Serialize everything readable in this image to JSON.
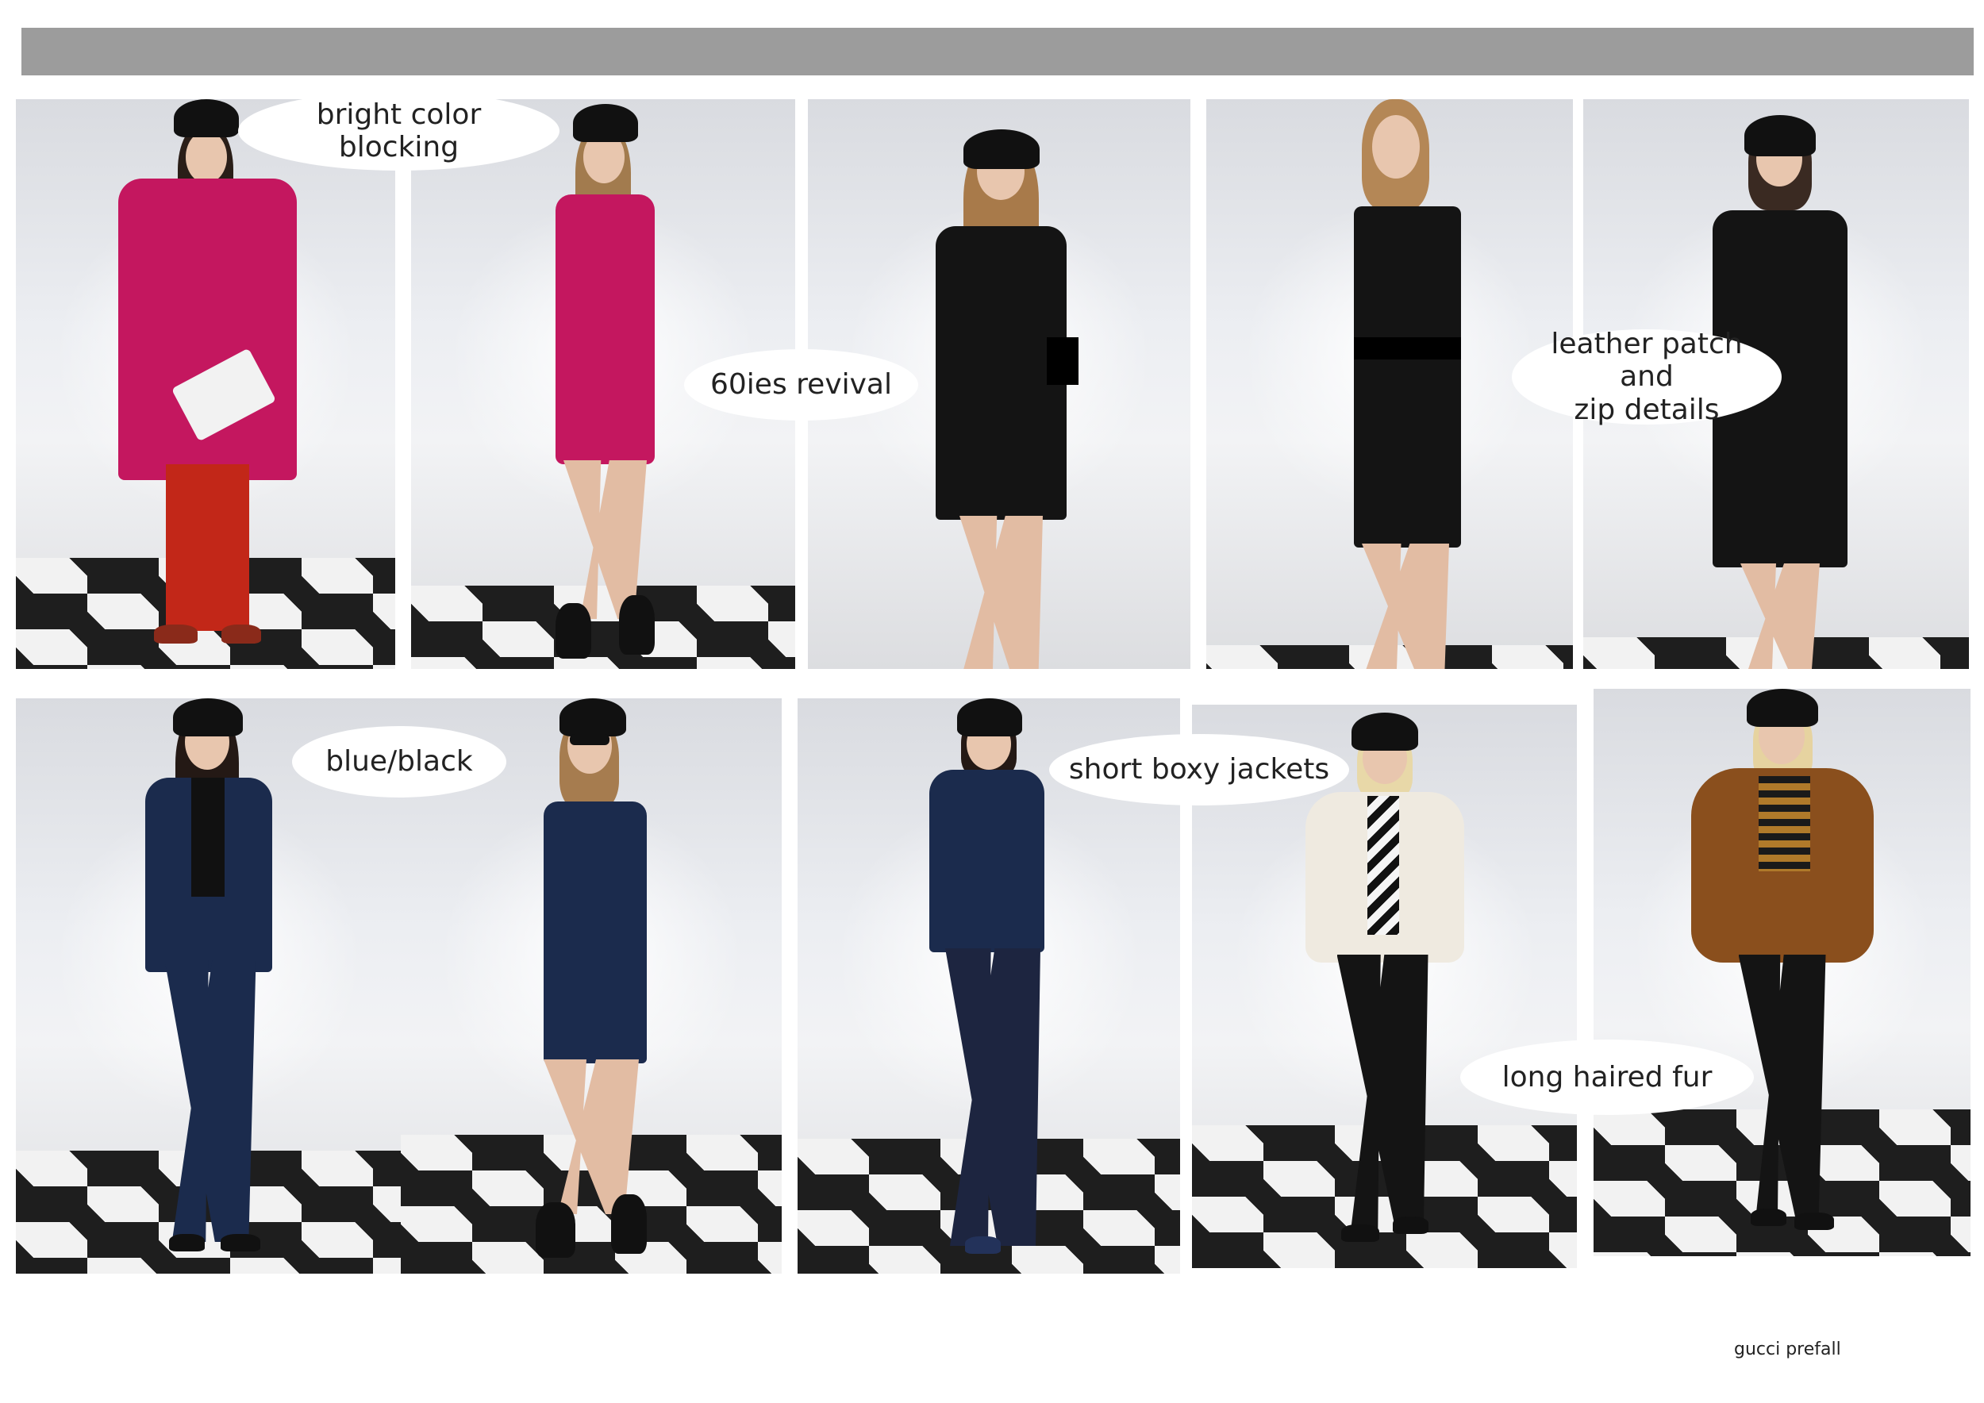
{
  "header": {
    "bar": ""
  },
  "annotations": {
    "color_blocking": "bright color blocking",
    "sixties": "60ies revival",
    "leather": "leather patch and\nzip details",
    "blue_black": "blue/black",
    "boxy": "short boxy jackets",
    "fur": "long haired fur"
  },
  "footer": {
    "label": "gucci prefall"
  },
  "colors": {
    "top_bar": "#9c9c9c",
    "magenta": "#c4175f",
    "red": "#c22718",
    "black": "#141414",
    "navy": "#1b2b4d",
    "cream_fur": "#efeae0",
    "brown_fur": "#8a4f1d"
  },
  "looks": [
    {
      "garment": "magenta wrap coat, red trousers, red loafers"
    },
    {
      "garment": "magenta sleeveless dress, black ankle boots"
    },
    {
      "garment": "black shift dress with leather cuffs"
    },
    {
      "garment": "black dress with leather harness panel"
    },
    {
      "garment": "black coat with zip and leather cuffs"
    },
    {
      "garment": "navy suit with black blouse"
    },
    {
      "garment": "navy sleeveless dress, black boots"
    },
    {
      "garment": "navy double-breasted short jacket, flared jeans"
    },
    {
      "garment": "cream long haired fur jacket, black trousers"
    },
    {
      "garment": "brown long haired fur jacket, striped top"
    }
  ]
}
